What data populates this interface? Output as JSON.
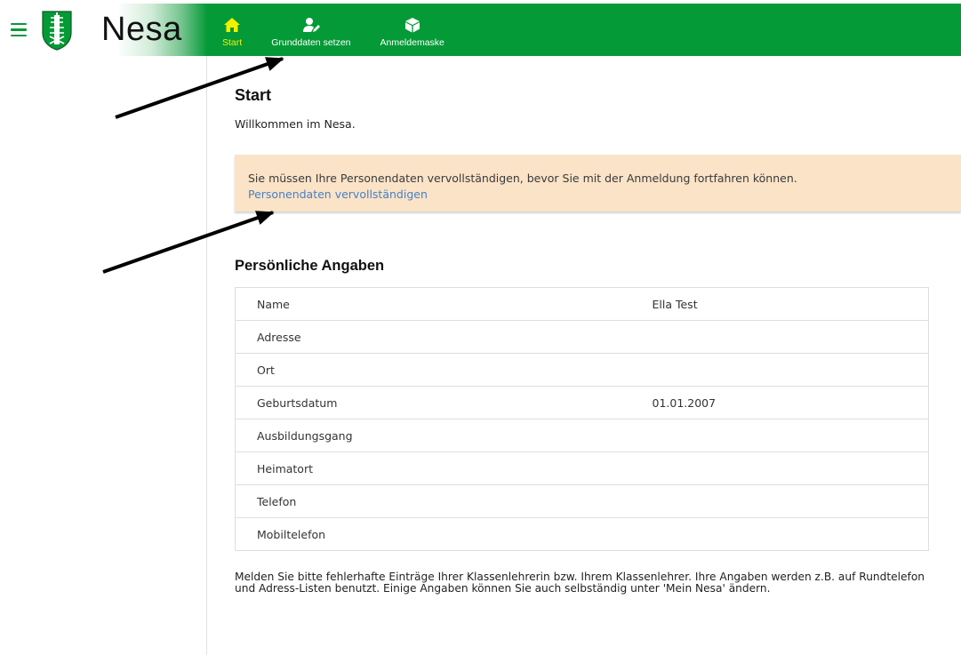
{
  "app": {
    "title": "Nesa"
  },
  "nav": {
    "items": [
      {
        "label": "Start",
        "icon": "home-icon",
        "active": true
      },
      {
        "label": "Grunddaten setzen",
        "icon": "user-edit-icon",
        "active": false
      },
      {
        "label": "Anmeldemaske",
        "icon": "cube-icon",
        "active": false
      }
    ]
  },
  "main": {
    "title": "Start",
    "welcome": "Willkommen im Nesa.",
    "alert": {
      "text": "Sie müssen Ihre Personendaten vervollständigen, bevor Sie mit der Anmeldung fortfahren können.",
      "link": "Personendaten vervollständigen"
    },
    "section_title": "Persönliche Angaben",
    "table": {
      "rows": [
        {
          "label": "Name",
          "value": "Ella Test"
        },
        {
          "label": "Adresse",
          "value": ""
        },
        {
          "label": "Ort",
          "value": ""
        },
        {
          "label": "Geburtsdatum",
          "value": "01.01.2007"
        },
        {
          "label": "Ausbildungsgang",
          "value": ""
        },
        {
          "label": "Heimatort",
          "value": ""
        },
        {
          "label": "Telefon",
          "value": ""
        },
        {
          "label": "Mobiltelefon",
          "value": ""
        }
      ]
    },
    "footer": "Melden Sie bitte fehlerhafte Einträge Ihrer Klassenlehrerin bzw. Ihrem Klassenlehrer. Ihre Angaben werden z.B. auf Rundtelefon und Adress-Listen benutzt. Einige Angaben können Sie auch selbständig unter 'Mein Nesa' ändern."
  },
  "colors": {
    "header_green": "#049a37",
    "active_nav": "#f4f000",
    "alert_bg": "#fae3c7",
    "link_blue": "#4a80c3"
  }
}
